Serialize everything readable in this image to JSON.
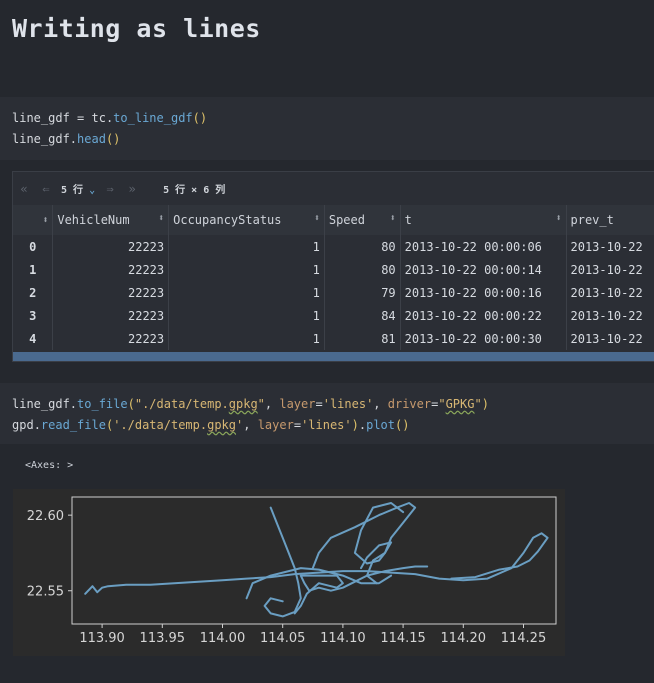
{
  "heading": "Writing as lines",
  "cell1": {
    "line1": {
      "var": "line_gdf",
      "op": " = ",
      "obj": "tc",
      "dot": ".",
      "fn": "to_line_gdf",
      "paren": "()"
    },
    "line2": {
      "var": "line_gdf",
      "dot": ".",
      "fn": "head",
      "paren": "()"
    }
  },
  "dataframe": {
    "rows_selector": "5 行",
    "info": "5 行 × 6 列",
    "nav_icons": [
      "first-page-icon",
      "prev-page-icon",
      "next-page-icon",
      "last-page-icon"
    ],
    "columns": [
      "",
      "VehicleNum",
      "OccupancyStatus",
      "Speed",
      "t",
      "prev_t"
    ],
    "rows": [
      [
        "0",
        "22223",
        "1",
        "80",
        "2013-10-22 00:00:06",
        "2013-10-22"
      ],
      [
        "1",
        "22223",
        "1",
        "80",
        "2013-10-22 00:00:14",
        "2013-10-22"
      ],
      [
        "2",
        "22223",
        "1",
        "79",
        "2013-10-22 00:00:16",
        "2013-10-22"
      ],
      [
        "3",
        "22223",
        "1",
        "84",
        "2013-10-22 00:00:22",
        "2013-10-22"
      ],
      [
        "4",
        "22223",
        "1",
        "81",
        "2013-10-22 00:00:30",
        "2013-10-22"
      ]
    ]
  },
  "cell2": {
    "line1": {
      "var": "line_gdf",
      "dot": ".",
      "fn": "to_file",
      "open": "(",
      "str1a": "\"./data/temp.",
      "str1b": "gpkg",
      "str1c": "\"",
      "sep1": ", ",
      "kw1": "layer",
      "eq": "=",
      "str2": "'lines'",
      "sep2": ", ",
      "kw2": "driver",
      "str3a": "\"",
      "str3b": "GPKG",
      "str3c": "\"",
      "close": ")"
    },
    "line2": {
      "var": "gpd",
      "dot": ".",
      "fn": "read_file",
      "open": "(",
      "str1a": "'./data/temp.",
      "str1b": "gpkg",
      "str1c": "'",
      "sep": ", ",
      "kw": "layer",
      "eq": "=",
      "str2": "'lines'",
      "close": ")",
      "dot2": ".",
      "fn2": "plot",
      "paren": "()"
    }
  },
  "output_text": "<Axes: >",
  "chart_data": {
    "type": "line",
    "title": "",
    "xlabel": "",
    "ylabel": "",
    "xlim": [
      113.875,
      114.277
    ],
    "ylim": [
      22.528,
      22.612
    ],
    "xticks": [
      "113.90",
      "113.95",
      "114.00",
      "114.05",
      "114.10",
      "114.15",
      "114.20",
      "114.25"
    ],
    "xtick_values": [
      113.9,
      113.95,
      114.0,
      114.05,
      114.1,
      114.15,
      114.2,
      114.25
    ],
    "yticks": [
      "22.55",
      "22.60"
    ],
    "ytick_values": [
      22.55,
      22.6
    ],
    "grid": false,
    "line_color": "#6a9ec2",
    "series": [
      {
        "values": [
          [
            113.886,
            22.548
          ],
          [
            113.892,
            22.553
          ],
          [
            113.896,
            22.549
          ],
          [
            113.9,
            22.552
          ],
          [
            113.905,
            22.553
          ],
          [
            113.92,
            22.554
          ],
          [
            113.94,
            22.554
          ],
          [
            113.96,
            22.555
          ],
          [
            113.98,
            22.556
          ],
          [
            114.0,
            22.557
          ],
          [
            114.02,
            22.558
          ],
          [
            114.04,
            22.559
          ],
          [
            114.06,
            22.561
          ],
          [
            114.08,
            22.562
          ],
          [
            114.1,
            22.563
          ],
          [
            114.12,
            22.563
          ],
          [
            114.14,
            22.562
          ],
          [
            114.16,
            22.561
          ],
          [
            114.18,
            22.558
          ],
          [
            114.2,
            22.557
          ],
          [
            114.22,
            22.558
          ],
          [
            114.24,
            22.565
          ],
          [
            114.25,
            22.575
          ],
          [
            114.258,
            22.585
          ],
          [
            114.265,
            22.588
          ],
          [
            114.27,
            22.585
          ],
          [
            114.262,
            22.576
          ],
          [
            114.255,
            22.57
          ],
          [
            114.245,
            22.566
          ],
          [
            114.23,
            22.564
          ],
          [
            114.21,
            22.559
          ],
          [
            114.19,
            22.558
          ]
        ]
      },
      {
        "values": [
          [
            114.02,
            22.545
          ],
          [
            114.025,
            22.555
          ],
          [
            114.04,
            22.56
          ],
          [
            114.05,
            22.562
          ],
          [
            114.065,
            22.565
          ],
          [
            114.08,
            22.564
          ],
          [
            114.1,
            22.56
          ],
          [
            114.115,
            22.555
          ],
          [
            114.13,
            22.555
          ],
          [
            114.14,
            22.56
          ]
        ]
      },
      {
        "values": [
          [
            114.075,
            22.565
          ],
          [
            114.08,
            22.575
          ],
          [
            114.09,
            22.585
          ],
          [
            114.11,
            22.592
          ],
          [
            114.13,
            22.6
          ],
          [
            114.145,
            22.605
          ],
          [
            114.155,
            22.608
          ],
          [
            114.16,
            22.605
          ],
          [
            114.15,
            22.595
          ],
          [
            114.14,
            22.585
          ],
          [
            114.135,
            22.575
          ],
          [
            114.13,
            22.57
          ],
          [
            114.12,
            22.568
          ],
          [
            114.11,
            22.575
          ],
          [
            114.115,
            22.59
          ],
          [
            114.125,
            22.605
          ],
          [
            114.14,
            22.608
          ],
          [
            114.15,
            22.602
          ]
        ]
      },
      {
        "values": [
          [
            114.04,
            22.605
          ],
          [
            114.045,
            22.595
          ],
          [
            114.05,
            22.585
          ],
          [
            114.055,
            22.575
          ],
          [
            114.06,
            22.565
          ],
          [
            114.063,
            22.555
          ],
          [
            114.065,
            22.545
          ],
          [
            114.06,
            22.536
          ],
          [
            114.05,
            22.533
          ],
          [
            114.04,
            22.535
          ],
          [
            114.035,
            22.54
          ],
          [
            114.04,
            22.545
          ],
          [
            114.05,
            22.543
          ]
        ]
      },
      {
        "values": [
          [
            114.065,
            22.56
          ],
          [
            114.068,
            22.555
          ],
          [
            114.072,
            22.55
          ],
          [
            114.08,
            22.552
          ],
          [
            114.09,
            22.55
          ],
          [
            114.1,
            22.552
          ],
          [
            114.11,
            22.556
          ],
          [
            114.12,
            22.56
          ],
          [
            114.135,
            22.563
          ],
          [
            114.15,
            22.565
          ],
          [
            114.16,
            22.566
          ],
          [
            114.17,
            22.566
          ]
        ]
      },
      {
        "values": [
          [
            114.115,
            22.565
          ],
          [
            114.12,
            22.572
          ],
          [
            114.13,
            22.58
          ],
          [
            114.14,
            22.582
          ],
          [
            114.135,
            22.575
          ],
          [
            114.125,
            22.57
          ],
          [
            114.12,
            22.56
          ],
          [
            114.128,
            22.555
          ]
        ]
      },
      {
        "values": [
          [
            114.065,
            22.56
          ],
          [
            114.075,
            22.56
          ],
          [
            114.095,
            22.56
          ],
          [
            114.1,
            22.555
          ],
          [
            114.095,
            22.552
          ],
          [
            114.08,
            22.555
          ],
          [
            114.07,
            22.548
          ],
          [
            114.065,
            22.54
          ],
          [
            114.06,
            22.535
          ]
        ]
      }
    ]
  }
}
